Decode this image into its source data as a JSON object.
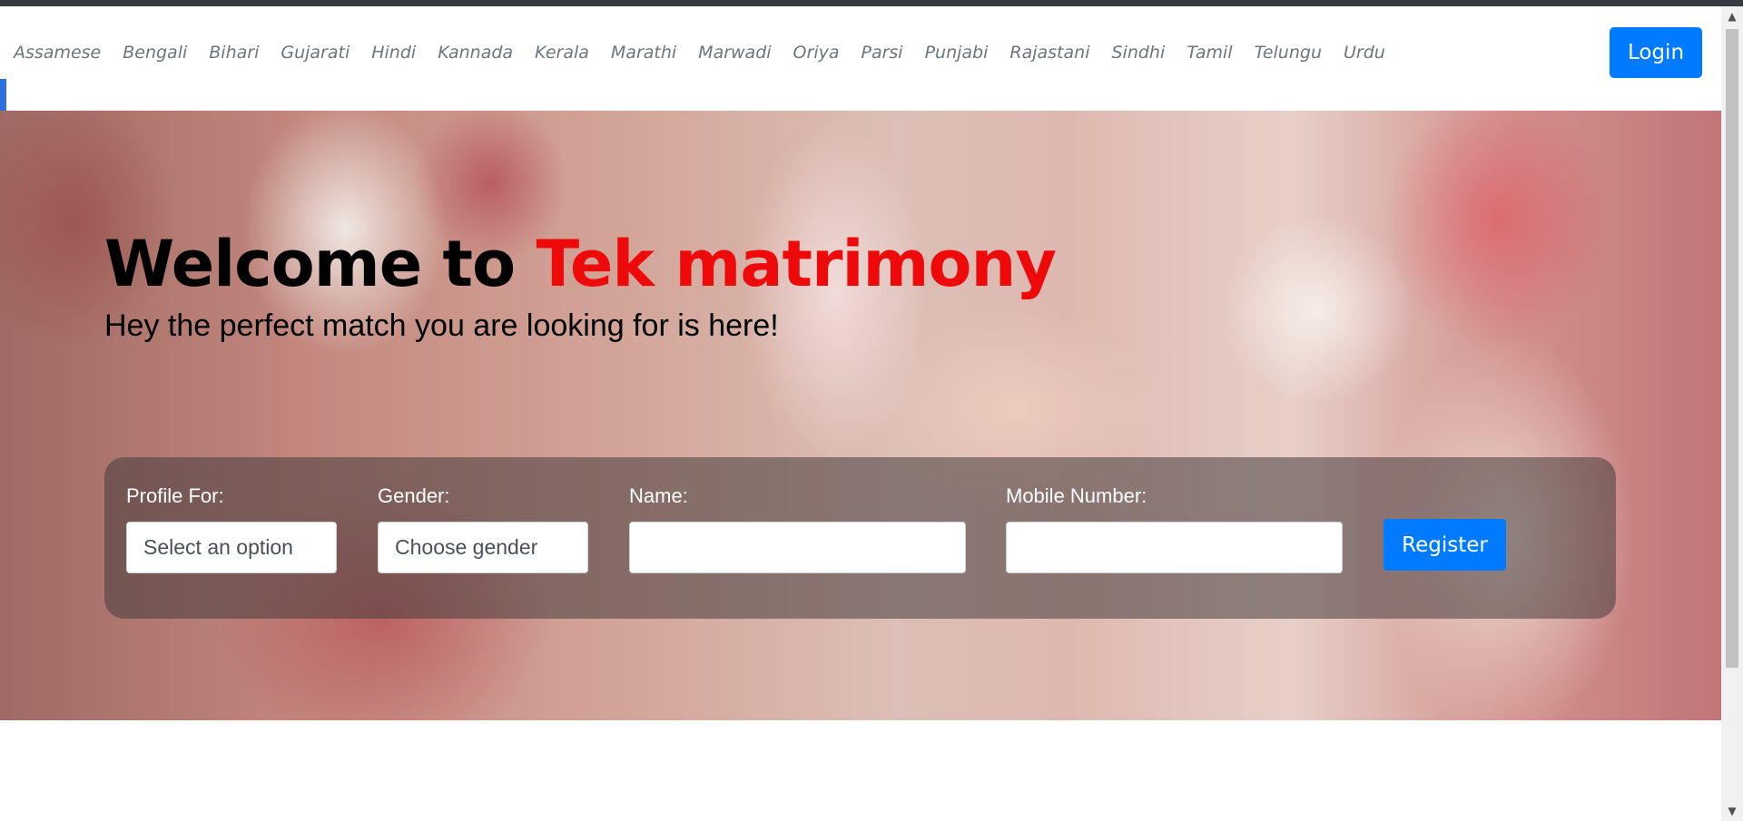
{
  "nav": {
    "links": [
      "Assamese",
      "Bengali",
      "Bihari",
      "Gujarati",
      "Hindi",
      "Kannada",
      "Kerala",
      "Marathi",
      "Marwadi",
      "Oriya",
      "Parsi",
      "Punjabi",
      "Rajastani",
      "Sindhi",
      "Tamil",
      "Telungu",
      "Urdu"
    ],
    "login_label": "Login"
  },
  "hero": {
    "title_prefix": "Welcome to ",
    "title_brand": "Tek matrimony",
    "subtitle": "Hey the perfect match you are looking for is here!"
  },
  "form": {
    "profile_for": {
      "label": "Profile For:",
      "value": "Select an option"
    },
    "gender": {
      "label": "Gender:",
      "value": "Choose gender"
    },
    "name": {
      "label": "Name:",
      "value": ""
    },
    "mobile": {
      "label": "Mobile Number:",
      "value": ""
    },
    "register_label": "Register"
  },
  "colors": {
    "brand_red": "#ee0a0a",
    "primary_blue": "#007bff",
    "nav_text": "#6c757d"
  },
  "icons": {
    "scroll_up": "scroll-up-arrow-icon",
    "scroll_down": "scroll-down-arrow-icon"
  }
}
